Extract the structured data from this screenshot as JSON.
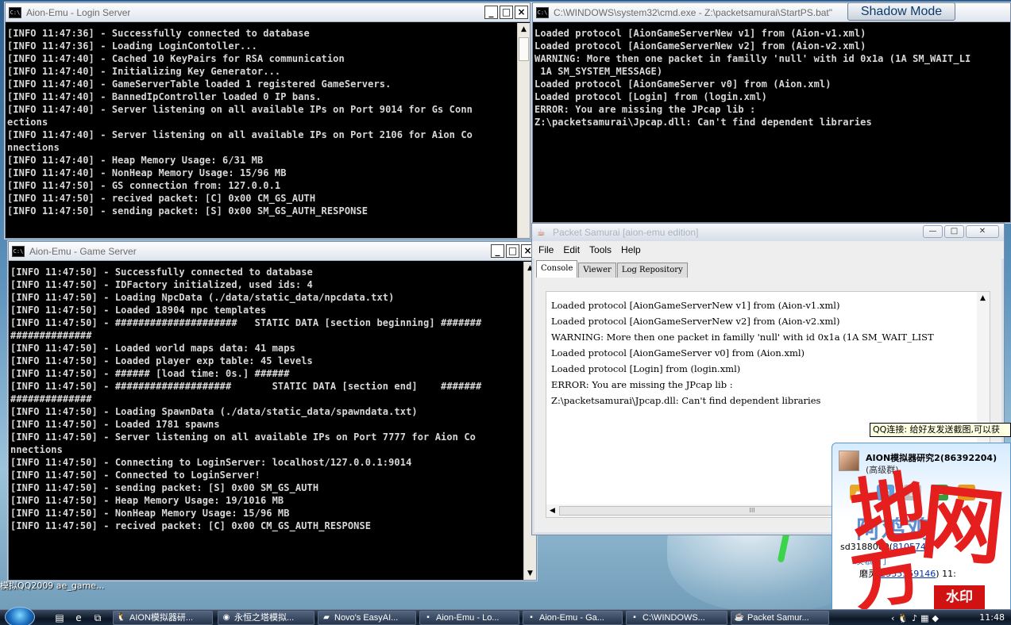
{
  "login_window": {
    "title": "Aion-Emu - Login Server",
    "icon_text": "C:\\",
    "lines": [
      "[INFO 11:47:36] - Successfully connected to database",
      "[INFO 11:47:36] - Loading LoginContoller...",
      "[INFO 11:47:40] - Cached 10 KeyPairs for RSA communication",
      "[INFO 11:47:40] - Initializing Key Generator...",
      "[INFO 11:47:40] - GameServerTable loaded 1 registered GameServers.",
      "[INFO 11:47:40] - BannedIpController loaded 0 IP bans.",
      "[INFO 11:47:40] - Server listening on all available IPs on Port 9014 for Gs Conn",
      "ections",
      "[INFO 11:47:40] - Server listening on all available IPs on Port 2106 for Aion Co",
      "nnections",
      "[INFO 11:47:40] - Heap Memory Usage: 6/31 MB",
      "[INFO 11:47:40] - NonHeap Memory Usage: 15/96 MB",
      "[INFO 11:47:50] - GS connection from: 127.0.0.1",
      "[INFO 11:47:50] - recived packet: [C] 0x00 CM_GS_AUTH",
      "[INFO 11:47:50] - sending packet: [S] 0x00 SM_GS_AUTH_RESPONSE"
    ]
  },
  "game_window": {
    "title": "Aion-Emu - Game Server",
    "icon_text": "C:\\",
    "lines": [
      "[INFO 11:47:50] - Successfully connected to database",
      "[INFO 11:47:50] - IDFactory initialized, used ids: 4",
      "[INFO 11:47:50] - Loading NpcData (./data/static_data/npcdata.txt)",
      "[INFO 11:47:50] - Loaded 18904 npc templates",
      "[INFO 11:47:50] - #####################   STATIC DATA [section beginning] #######",
      "##############",
      "[INFO 11:47:50] - Loaded world maps data: 41 maps",
      "[INFO 11:47:50] - Loaded player exp table: 45 levels",
      "[INFO 11:47:50] - ###### [load time: 0s.] ######",
      "[INFO 11:47:50] - ####################       STATIC DATA [section end]    #######",
      "##############",
      "[INFO 11:47:50] - Loading SpawnData (./data/static_data/spawndata.txt)",
      "[INFO 11:47:50] - Loaded 1781 spawns",
      "[INFO 11:47:50] - Server listening on all available IPs on Port 7777 for Aion Co",
      "nnections",
      "[INFO 11:47:50] - Connecting to LoginServer: localhost/127.0.0.1:9014",
      "[INFO 11:47:50] - Connected to LoginServer!",
      "[INFO 11:47:50] - sending packet: [S] 0x00 SM_GS_AUTH",
      "[INFO 11:47:50] - Heap Memory Usage: 19/1016 MB",
      "[INFO 11:47:50] - NonHeap Memory Usage: 15/96 MB",
      "[INFO 11:47:50] - recived packet: [C] 0x00 CM_GS_AUTH_RESPONSE"
    ]
  },
  "cmd_window": {
    "title": "C:\\WINDOWS\\system32\\cmd.exe - Z:\\packetsamurai\\StartPS.bat\"",
    "icon_text": "C:\\",
    "lines": [
      "Loaded protocol [AionGameServerNew v1] from (Aion-v1.xml)",
      "Loaded protocol [AionGameServerNew v2] from (Aion-v2.xml)",
      "WARNING: More then one packet in familly 'null' with id 0x1a (1A SM_WAIT_LI",
      " 1A SM_SYSTEM_MESSAGE)",
      "Loaded protocol [AionGameServer v0] from (Aion.xml)",
      "Loaded protocol [Login] from (login.xml)",
      "ERROR: You are missing the JPcap lib :",
      "Z:\\packetsamurai\\Jpcap.dll: Can't find dependent libraries"
    ]
  },
  "shadow_mode": {
    "label": "Shadow Mode"
  },
  "java_window": {
    "title": "Packet Samurai [aion-emu edition]",
    "menu": [
      "File",
      "Edit",
      "Tools",
      "Help"
    ],
    "tabs": [
      "Console",
      "Viewer",
      "Log Repository"
    ],
    "active_tab": "Console",
    "console_lines": [
      "Loaded protocol [AionGameServerNew v1] from (Aion-v1.xml)",
      "Loaded protocol [AionGameServerNew v2] from (Aion-v2.xml)",
      "WARNING: More then one packet in familly 'null' with id 0x1a (1A SM_WAIT_LIST",
      "Loaded protocol [AionGameServer v0] from (Aion.xml)",
      "Loaded protocol [Login] from (login.xml)",
      "ERROR: You are missing the JPcap lib :",
      "Z:\\packetsamurai\\Jpcap.dll: Can't find dependent libraries"
    ],
    "hscroll_grip": "III"
  },
  "qq_tooltip": "QQ连接: 给好友发送截图,可以获",
  "qq_panel": {
    "group_name": "AION模拟器研究2(86392204)",
    "group_level": "(高级群)",
    "big_text": "阿鸡鸡",
    "line1_user": "sd3188000",
    "line1_id": "810574",
    "line2": "羡慕   们",
    "line3_user": "磨灵",
    "line3_id": "2535559146",
    "line3_time": "11:"
  },
  "watermark": {
    "chars": [
      "地",
      "网",
      "方"
    ],
    "badge": "水印"
  },
  "desktop_label": "模拟QQ2009  ae_game...",
  "taskbar": {
    "items": [
      "AION模拟器研...",
      "永恒之塔模拟...",
      "Novo's EasyAI...",
      "Aion-Emu - Lo...",
      "Aion-Emu - Ga...",
      "C:\\WINDOWS...",
      "Packet Samur..."
    ],
    "clock": "11:48"
  },
  "colors": {
    "console_text": "#d8d8d8",
    "watermark_red": "#e51e1e",
    "desktop_blue": "#2c5f8f"
  }
}
